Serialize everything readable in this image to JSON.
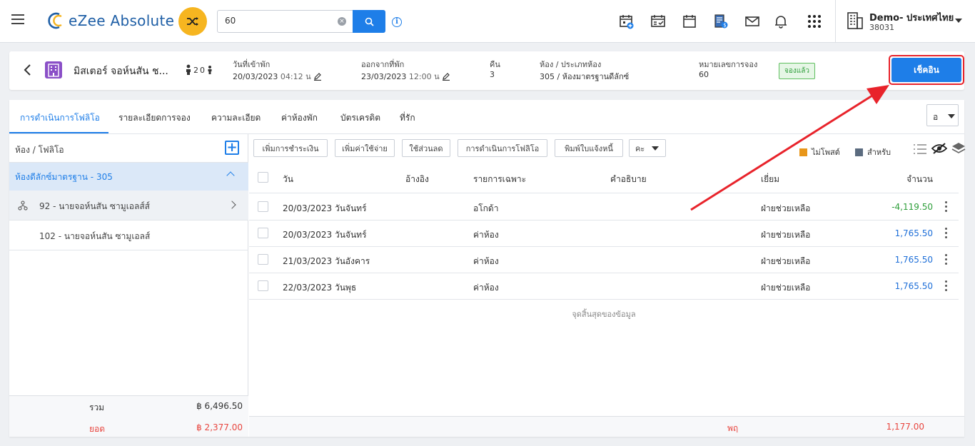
{
  "header": {
    "app_name": "eZee Absolute",
    "search_value": "60",
    "property_name": "Demo- ประเทศไทย",
    "property_code": "38031"
  },
  "reservation": {
    "guest_name": "มิสเตอร์ จอห์นสัน ช...",
    "adults": "2",
    "children": "0",
    "checkin_label": "วันที่เข้าพัก",
    "checkin_date": "20/03/2023",
    "checkin_time": "04:12 น",
    "checkout_label": "ออกจากที่พัก",
    "checkout_date": "23/03/2023",
    "checkout_time": "12:00 น",
    "nights_label": "คืน",
    "nights": "3",
    "room_label": "ห้อง / ประเภทห้อง",
    "room_value": "305 / ห้องมาตรฐานดีลักซ์",
    "res_no_label": "หมายเลขการจอง",
    "res_no": "60",
    "status": "จองแล้ว",
    "checkin_button": "เช็คอิน"
  },
  "tabs": [
    "การดำเนินการโฟลิโอ",
    "รายละเอียดการจอง",
    "ความละเอียด",
    "ค่าห้องพัก",
    "บัตรเครดิต",
    "ที่รัก"
  ],
  "tab_select": "อ",
  "folios": {
    "title": "ห้อง / โฟลิโอ",
    "room_group": "ห้องดีลักซ์มาตรฐาน - 305",
    "items": [
      "92 - นายจอห์นสัน ซามูเอลส์ส์",
      "102 - นายจอห์นสัน ซามูเอลส์"
    ],
    "total_label": "รวม",
    "total_value": "฿ 6,496.50",
    "balance_label": "ยอด",
    "balance_value": "฿ 2,377.00"
  },
  "actions": [
    "เพิ่มการชำระเงิน",
    "เพิ่มค่าใช้จ่าย",
    "ใช้ส่วนลด",
    "การดำเนินการโฟลิโอ",
    "พิมพ์ใบแจ้งหนี้",
    "คะ"
  ],
  "legend": {
    "unposted": "ไม่โพสต์",
    "unposted_color": "#e8961a",
    "for": "สำหรับ",
    "for_color": "#5b6b7f"
  },
  "table": {
    "columns": [
      "วัน",
      "อ้างอิง",
      "รายการเฉพาะ",
      "คำอธิบาย",
      "เยี่ยม",
      "จำนวน"
    ],
    "rows": [
      {
        "date": "20/03/2023 วันจันทร์",
        "ref": "",
        "particular": "อโกด้า",
        "desc": "",
        "user": "ฝ่ายช่วยเหลือ",
        "amount": "-4,119.50",
        "color": "#2e9e3a"
      },
      {
        "date": "20/03/2023 วันจันทร์",
        "ref": "",
        "particular": "ค่าห้อง",
        "desc": "",
        "user": "ฝ่ายช่วยเหลือ",
        "amount": "1,765.50",
        "color": "#1e6fd8"
      },
      {
        "date": "21/03/2023 วันอังคาร",
        "ref": "",
        "particular": "ค่าห้อง",
        "desc": "",
        "user": "ฝ่ายช่วยเหลือ",
        "amount": "1,765.50",
        "color": "#1e6fd8"
      },
      {
        "date": "22/03/2023 วันพุธ",
        "ref": "",
        "particular": "ค่าห้อง",
        "desc": "",
        "user": "ฝ่ายช่วยเหลือ",
        "amount": "1,765.50",
        "color": "#1e6fd8"
      }
    ],
    "end_text": "จุดสิ้นสุดของข้อมูล",
    "footer_label": "พฤ",
    "footer_value": "1,177.00"
  },
  "colors": {
    "accent": "#1e7ee8",
    "negative": "#e8463f",
    "highlight_arrow": "#e8232b"
  }
}
